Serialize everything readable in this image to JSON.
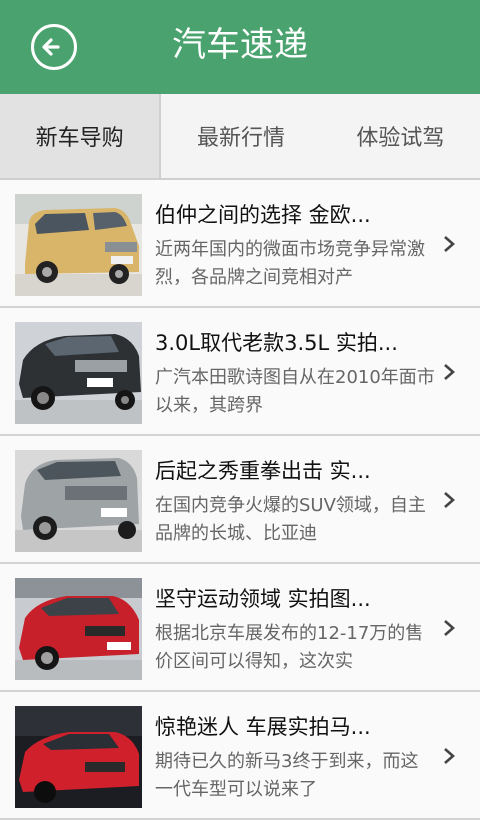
{
  "header": {
    "title": "汽车速递"
  },
  "tabs": [
    {
      "label": "新车导购",
      "active": true
    },
    {
      "label": "最新行情",
      "active": false
    },
    {
      "label": "体验试驾",
      "active": false
    }
  ],
  "articles": [
    {
      "title": "伯仲之间的选择 金欧...",
      "summary": "近两年国内的微面市场竞争异常激烈，各品牌之间竞相对产",
      "image": "gold-minivan"
    },
    {
      "title": "3.0L取代老款3.5L 实拍...",
      "summary": "广汽本田歌诗图自从在2010年面市以来，其跨界",
      "image": "black-honda-crossover"
    },
    {
      "title": "后起之秀重拳出击 实...",
      "summary": "在国内竞争火爆的SUV领域，自主品牌的长城、比亚迪",
      "image": "silver-suv"
    },
    {
      "title": "坚守运动领域 实拍图...",
      "summary": "根据北京车展发布的12-17万的售价区间可以得知，这次实",
      "image": "red-mazda-sedan"
    },
    {
      "title": "惊艳迷人 车展实拍马...",
      "summary": "期待已久的新马3终于到来，而这一代车型可以说来了",
      "image": "red-mazda3-show"
    }
  ],
  "colors": {
    "header": "#4aa36e",
    "tab_active": "#e2e2e2"
  }
}
